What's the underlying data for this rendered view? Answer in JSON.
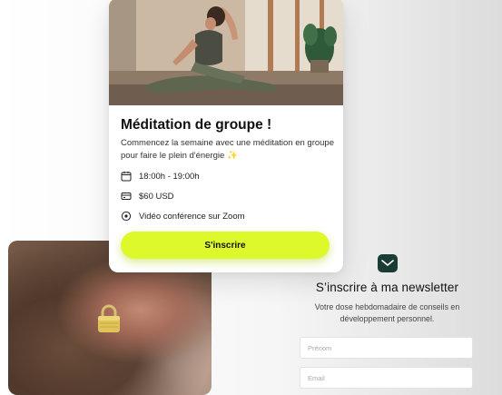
{
  "event": {
    "title": "Méditation de groupe !",
    "description": "Commencez la semaine avec une méditation en groupe pour faire le plein d'énergie ✨",
    "time": "18:00h - 19:00h",
    "price": "$60 USD",
    "location": "Vidéo conférence sur Zoom",
    "cta_label": "S'inscrire"
  },
  "newsletter": {
    "title": "S’inscrire à ma newsletter",
    "description": "Votre dose hebdomadaire de conseils en développement personnel.",
    "first_name_placeholder": "Prénom",
    "email_placeholder": "Email"
  },
  "icons": {
    "time": "calendar-icon",
    "price": "card-icon",
    "location": "location-pin-icon",
    "newsletter": "mail-icon",
    "locked": "lock-icon"
  },
  "colors": {
    "cta": "#ddf92b",
    "mail_icon_bg": "#1b3b35"
  }
}
